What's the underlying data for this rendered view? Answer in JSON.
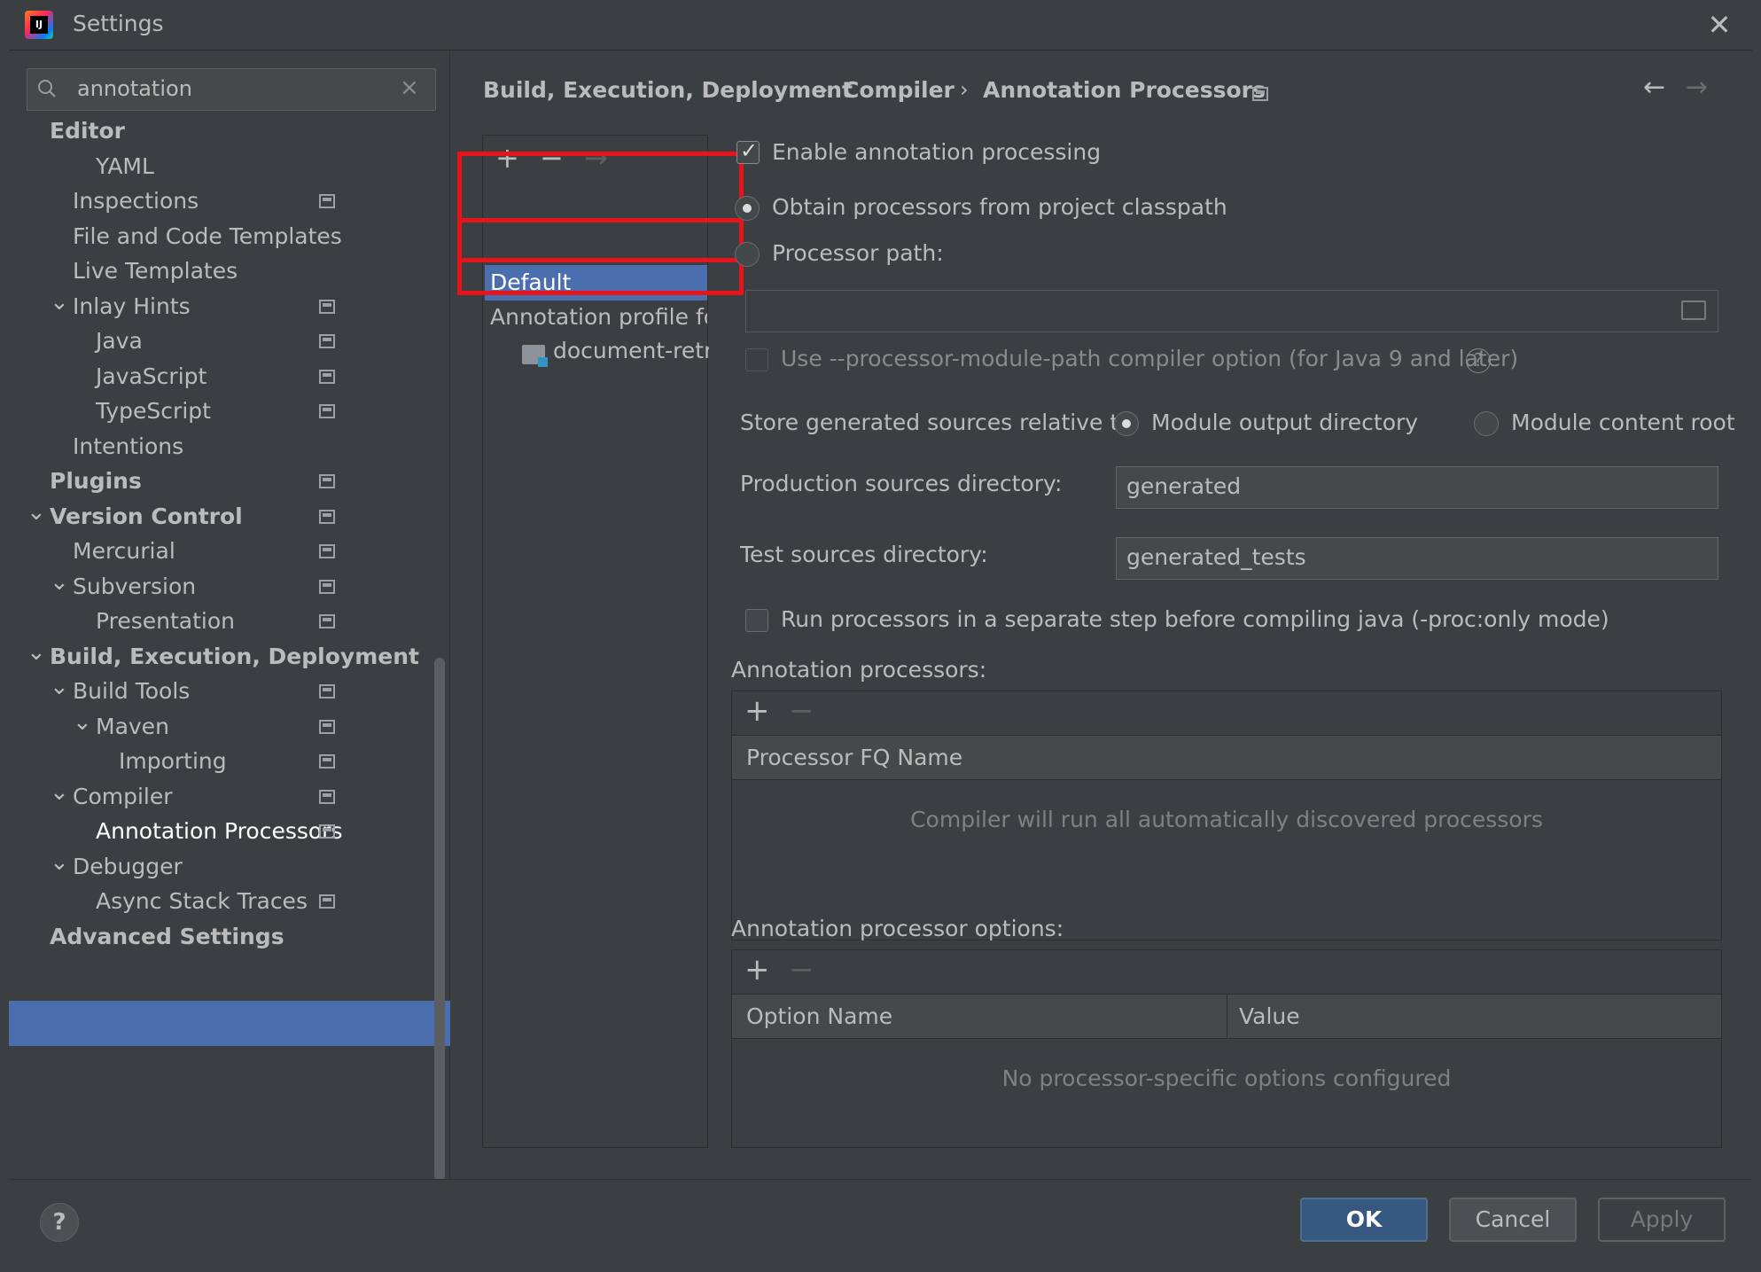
{
  "window": {
    "title": "Settings"
  },
  "search": {
    "value": "annotation"
  },
  "tree": [
    {
      "label": "Editor",
      "bold": true,
      "level": 0
    },
    {
      "label": "YAML",
      "level": 2
    },
    {
      "label": "Inspections",
      "level": 1
    },
    {
      "label": "File and Code Templates",
      "level": 1
    },
    {
      "label": "Live Templates",
      "level": 1
    },
    {
      "label": "Inlay Hints",
      "level": 1
    },
    {
      "label": "Java",
      "level": 2
    },
    {
      "label": "JavaScript",
      "level": 2
    },
    {
      "label": "TypeScript",
      "level": 2
    },
    {
      "label": "Intentions",
      "level": 1
    },
    {
      "label": "Plugins",
      "bold": true,
      "level": 0
    },
    {
      "label": "Version Control",
      "bold": true,
      "level": 0
    },
    {
      "label": "Mercurial",
      "level": 1
    },
    {
      "label": "Subversion",
      "level": 1
    },
    {
      "label": "Presentation",
      "level": 2
    },
    {
      "label": "Build, Execution, Deployment",
      "bold": true,
      "level": 0
    },
    {
      "label": "Build Tools",
      "level": 1
    },
    {
      "label": "Maven",
      "level": 2
    },
    {
      "label": "Importing",
      "level": 3
    },
    {
      "label": "Compiler",
      "level": 1
    },
    {
      "label": "Annotation Processors",
      "level": 2,
      "selected": true
    },
    {
      "label": "Debugger",
      "level": 1
    },
    {
      "label": "Async Stack Traces",
      "level": 2
    },
    {
      "label": "Advanced Settings",
      "bold": true,
      "level": 0
    }
  ],
  "breadcrumb": {
    "items": [
      "Build, Execution, Deployment",
      "Compiler",
      "Annotation Processors"
    ],
    "separator": "›"
  },
  "profiles": {
    "add": "+",
    "remove": "−",
    "move": "→",
    "default_label": "Default",
    "annotation_profile_label": "Annotation profile for",
    "module_label": "document-retri"
  },
  "form": {
    "enable_processing": "Enable annotation processing",
    "obtain_from_classpath": "Obtain processors from project classpath",
    "processor_path": "Processor path:",
    "processor_path_value": "",
    "module_path_option": "Use --processor-module-path compiler option (for Java 9 and later)",
    "store_relative_label": "Store generated sources relative to:",
    "module_output_dir": "Module output directory",
    "module_content_root": "Module content root",
    "production_dir_label": "Production sources directory:",
    "production_dir_value": "generated",
    "test_dir_label": "Test sources directory:",
    "test_dir_value": "generated_tests",
    "separate_step": "Run processors in a separate step before compiling java (-proc:only mode)"
  },
  "processors_table": {
    "title": "Annotation processors:",
    "column": "Processor FQ Name",
    "empty": "Compiler will run all automatically discovered processors"
  },
  "options_table": {
    "title": "Annotation processor options:",
    "col_name": "Option Name",
    "col_value": "Value",
    "empty": "No processor-specific options configured"
  },
  "buttons": {
    "ok": "OK",
    "cancel": "Cancel",
    "apply": "Apply",
    "help": "?"
  },
  "colors": {
    "selection": "#4b6eaf",
    "highlight": "#e8141c",
    "background": "#3c3f41"
  }
}
